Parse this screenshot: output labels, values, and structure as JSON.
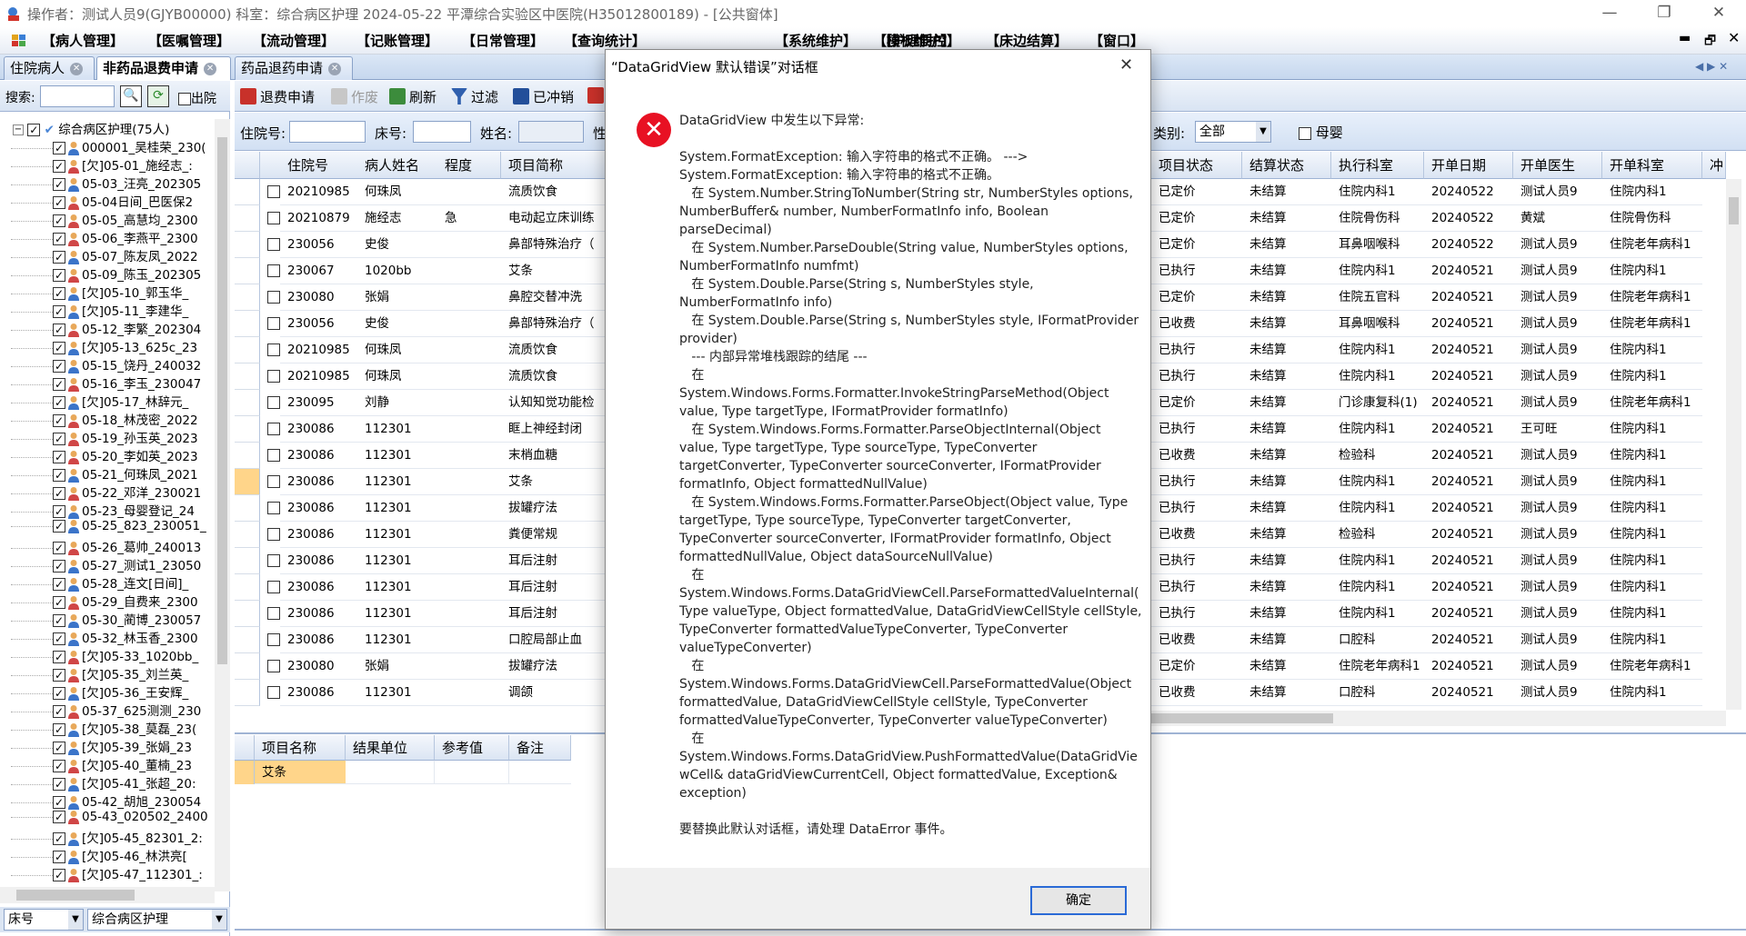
{
  "titlebar": {
    "text": "操作者：测试人员9(GJYB00000)  科室：综合病区护理  2024-05-22  平潭综合实验区中医院(H35012800189) - [公共窗体]"
  },
  "menus": [
    "【病人管理】",
    "【医嘱管理】",
    "【流动管理】",
    "【记账管理】",
    "【日常管理】",
    "【查询统计】",
    "【系统维护】",
    "【模板维护】",
    "【护理质控】",
    "【床边结算】",
    "【窗口】"
  ],
  "tabs": [
    "住院病人",
    "非药品退费申请",
    "药品退药申请"
  ],
  "left": {
    "search_label": "搜索:",
    "out_label": "出院",
    "root": "综合病区护理(75人)",
    "patients": [
      "000001_吴桂荣_230(",
      "[欠]05-01_施经志_:",
      "05-03_汪亮_202305",
      "05-04日间_巴医保2",
      "05-05_高慧均_2300",
      "05-06_李燕平_2300",
      "05-07_陈友凤_2022",
      "05-09_陈玉_202305",
      "[欠]05-10_郭玉华_",
      "[欠]05-11_李建华_",
      "05-12_李繁_202304",
      "[欠]05-13_625c_23",
      "05-15_饶丹_240032",
      "05-16_李玉_230047",
      "[欠]05-17_林辞元_",
      "05-18_林茂密_2022",
      "05-19_孙玉英_2023",
      "05-20_李如英_2023",
      "05-21_何珠凤_2021",
      "05-22_邓洋_230021",
      "05-23_母婴登记_24",
      "05-25_823_230051_",
      "05-26_葛帅_240013",
      "05-27_测试1_23050",
      "05-28_连文[日间]_",
      "05-29_自费来_2300",
      "05-30_蔺博_230057",
      "05-32_林玉香_2300",
      "[欠]05-33_1020bb_",
      "[欠]05-35_刘兰英_",
      "[欠]05-36_王安辉_",
      "05-37_625测测_230",
      "[欠]05-38_莫磊_23(",
      "[欠]05-39_张娟_23",
      "[欠]05-40_董楠_23",
      "[欠]05-41_张超_20:",
      "05-42_胡旭_230054",
      "05-43_020502_2400",
      "[欠]05-45_82301_2:",
      "[欠]05-46_林洪亮[",
      "[欠]05-47_112301_:"
    ],
    "bottom_left": "床号",
    "bottom_right": "综合病区护理"
  },
  "toolbar": [
    "退费申请",
    "作废",
    "刷新",
    "过滤",
    "已冲销"
  ],
  "filter": {
    "zyh": "住院号:",
    "bed": "床号:",
    "name": "姓名:",
    "type_label": "类别:",
    "type_value": "全部",
    "mother_baby": "母婴"
  },
  "grid": {
    "left_headers": [
      "住院号",
      "病人姓名",
      "程度",
      "项目简称"
    ],
    "right_headers": [
      "项目状态",
      "结算状态",
      "执行科室",
      "开单日期",
      "开单医生",
      "开单科室",
      "冲"
    ],
    "rows": [
      [
        "20210985",
        "何珠凤",
        "",
        "流质饮食",
        "已定价",
        "未结算",
        "住院内科1",
        "20240522",
        "测试人员9",
        "住院内科1"
      ],
      [
        "20210879",
        "施经志",
        "急",
        "电动起立床训练",
        "已定价",
        "未结算",
        "住院骨伤科",
        "20240522",
        "黄斌",
        "住院骨伤科"
      ],
      [
        "230056",
        "史俊",
        "",
        "鼻部特殊治疗（",
        "已定价",
        "未结算",
        "耳鼻咽喉科",
        "20240522",
        "测试人员9",
        "住院老年病科1"
      ],
      [
        "230067",
        "1020bb",
        "",
        "艾条",
        "已执行",
        "未结算",
        "住院内科1",
        "20240521",
        "测试人员9",
        "住院内科1"
      ],
      [
        "230080",
        "张娟",
        "",
        "鼻腔交替冲洗",
        "已定价",
        "未结算",
        "住院五官科",
        "20240521",
        "测试人员9",
        "住院老年病科1"
      ],
      [
        "230056",
        "史俊",
        "",
        "鼻部特殊治疗（",
        "已收费",
        "未结算",
        "耳鼻咽喉科",
        "20240521",
        "测试人员9",
        "住院老年病科1"
      ],
      [
        "20210985",
        "何珠凤",
        "",
        "流质饮食",
        "已执行",
        "未结算",
        "住院内科1",
        "20240521",
        "测试人员9",
        "住院内科1"
      ],
      [
        "20210985",
        "何珠凤",
        "",
        "流质饮食",
        "已执行",
        "未结算",
        "住院内科1",
        "20240521",
        "测试人员9",
        "住院内科1"
      ],
      [
        "230095",
        "刘静",
        "",
        "认知知觉功能检",
        "已定价",
        "未结算",
        "门诊康复科(1)",
        "20240521",
        "测试人员9",
        "住院老年病科1"
      ],
      [
        "230086",
        "112301",
        "",
        "眶上神经封闭",
        "已执行",
        "未结算",
        "住院内科1",
        "20240521",
        "王可旺",
        "住院内科1"
      ],
      [
        "230086",
        "112301",
        "",
        "末梢血糖",
        "已收费",
        "未结算",
        "检验科",
        "20240521",
        "测试人员9",
        "住院内科1"
      ],
      [
        "230086",
        "112301",
        "",
        "艾条",
        "已执行",
        "未结算",
        "住院内科1",
        "20240521",
        "测试人员9",
        "住院内科1"
      ],
      [
        "230086",
        "112301",
        "",
        "拔罐疗法",
        "已执行",
        "未结算",
        "住院内科1",
        "20240521",
        "测试人员9",
        "住院内科1"
      ],
      [
        "230086",
        "112301",
        "",
        "粪便常规",
        "已收费",
        "未结算",
        "检验科",
        "20240521",
        "测试人员9",
        "住院内科1"
      ],
      [
        "230086",
        "112301",
        "",
        "耳后注射",
        "已执行",
        "未结算",
        "住院内科1",
        "20240521",
        "测试人员9",
        "住院内科1"
      ],
      [
        "230086",
        "112301",
        "",
        "耳后注射",
        "已执行",
        "未结算",
        "住院内科1",
        "20240521",
        "测试人员9",
        "住院内科1"
      ],
      [
        "230086",
        "112301",
        "",
        "耳后注射",
        "已执行",
        "未结算",
        "住院内科1",
        "20240521",
        "测试人员9",
        "住院内科1"
      ],
      [
        "230086",
        "112301",
        "",
        "口腔局部止血",
        "已收费",
        "未结算",
        "口腔科",
        "20240521",
        "测试人员9",
        "住院内科1"
      ],
      [
        "230080",
        "张娟",
        "",
        "拔罐疗法",
        "已定价",
        "未结算",
        "住院老年病科1",
        "20240521",
        "测试人员9",
        "住院老年病科1"
      ],
      [
        "230086",
        "112301",
        "",
        "调颌",
        "已收费",
        "未结算",
        "口腔科",
        "20240521",
        "测试人员9",
        "住院内科1"
      ]
    ],
    "selected_row": 11
  },
  "subgrid": {
    "headers": [
      "项目名称",
      "结果单位",
      "参考值",
      "备注"
    ],
    "row": [
      "艾条",
      "",
      "",
      ""
    ]
  },
  "dialog": {
    "title": "“DataGridView 默认错误”对话框",
    "heading": "DataGridView 中发生以下异常:",
    "body": "System.FormatException: 输入字符串的格式不正确。 --->\nSystem.FormatException: 输入字符串的格式不正确。\n   在 System.Number.StringToNumber(String str, NumberStyles options,\nNumberBuffer& number, NumberFormatInfo info, Boolean\nparseDecimal)\n   在 System.Number.ParseDouble(String value, NumberStyles options,\nNumberFormatInfo numfmt)\n   在 System.Double.Parse(String s, NumberStyles style,\nNumberFormatInfo info)\n   在 System.Double.Parse(String s, NumberStyles style, IFormatProvider\nprovider)\n   --- 内部异常堆栈跟踪的结尾 ---\n   在\nSystem.Windows.Forms.Formatter.InvokeStringParseMethod(Object\nvalue, Type targetType, IFormatProvider formatInfo)\n   在 System.Windows.Forms.Formatter.ParseObjectInternal(Object\nvalue, Type targetType, Type sourceType, TypeConverter\ntargetConverter, TypeConverter sourceConverter, IFormatProvider\nformatInfo, Object formattedNullValue)\n   在 System.Windows.Forms.Formatter.ParseObject(Object value, Type\ntargetType, Type sourceType, TypeConverter targetConverter,\nTypeConverter sourceConverter, IFormatProvider formatInfo, Object\nformattedNullValue, Object dataSourceNullValue)\n   在\nSystem.Windows.Forms.DataGridViewCell.ParseFormattedValueInternal(\nType valueType, Object formattedValue, DataGridViewCellStyle cellStyle,\nTypeConverter formattedValueTypeConverter, TypeConverter\nvalueTypeConverter)\n   在\nSystem.Windows.Forms.DataGridViewCell.ParseFormattedValue(Object\nformattedValue, DataGridViewCellStyle cellStyle, TypeConverter\nformattedValueTypeConverter, TypeConverter valueTypeConverter)\n   在\nSystem.Windows.Forms.DataGridView.PushFormattedValue(DataGridVie\nwCell& dataGridViewCurrentCell, Object formattedValue, Exception&\nexception)",
    "footer_note": "要替换此默认对话框，请处理 DataError 事件。",
    "ok": "确定"
  },
  "colors": {
    "accent": "#2a6ad6",
    "error": "#e81123",
    "selected_row": "#ffd58a",
    "header_bg": "#dbe5f3"
  }
}
